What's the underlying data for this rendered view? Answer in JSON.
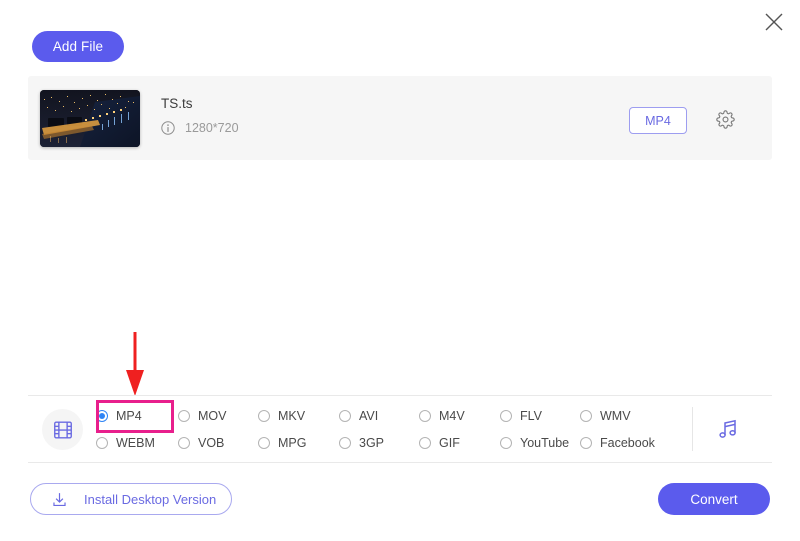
{
  "window": {
    "close_label": "×"
  },
  "toolbar": {
    "add_file_label": "Add File"
  },
  "file": {
    "name": "TS.ts",
    "resolution": "1280*720",
    "output_format_badge": "MP4",
    "info_icon": "info-icon",
    "settings_icon": "gear-icon",
    "thumbnail_alt": "night city aerial view"
  },
  "format_bar": {
    "video_icon": "film-strip-icon",
    "audio_icon": "music-note-icon",
    "selected": "MP4",
    "rows": [
      [
        {
          "label": "MP4",
          "checked": true
        },
        {
          "label": "MOV",
          "checked": false
        },
        {
          "label": "MKV",
          "checked": false
        },
        {
          "label": "AVI",
          "checked": false
        },
        {
          "label": "M4V",
          "checked": false
        },
        {
          "label": "FLV",
          "checked": false
        },
        {
          "label": "WMV",
          "checked": false
        }
      ],
      [
        {
          "label": "WEBM",
          "checked": false
        },
        {
          "label": "VOB",
          "checked": false
        },
        {
          "label": "MPG",
          "checked": false
        },
        {
          "label": "3GP",
          "checked": false
        },
        {
          "label": "GIF",
          "checked": false
        },
        {
          "label": "YouTube",
          "checked": false
        },
        {
          "label": "Facebook",
          "checked": false
        }
      ]
    ]
  },
  "footer": {
    "install_label": "Install Desktop Version",
    "install_icon": "download-icon",
    "convert_label": "Convert"
  },
  "annotation": {
    "arrow_color": "#ef2020",
    "highlight_color": "#e81f8c",
    "points_at": "MP4"
  },
  "colors": {
    "accent": "#5b5bed",
    "accent_light": "#a9a9ef",
    "radio_selected": "#2f84f5",
    "card_bg": "#f6f6f6"
  }
}
